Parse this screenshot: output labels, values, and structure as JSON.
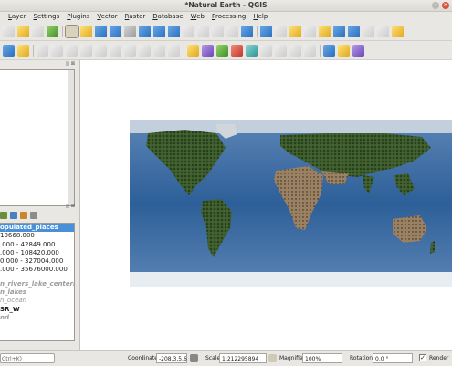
{
  "window": {
    "title": "*Natural Earth - QGIS"
  },
  "menubar": [
    "Layer",
    "Settings",
    "Plugins",
    "Vector",
    "Raster",
    "Database",
    "Web",
    "Processing",
    "Help"
  ],
  "layers": {
    "items": [
      {
        "label": "opulated_places",
        "style": "selected"
      },
      {
        "label": " 10668.000",
        "style": "normal"
      },
      {
        "label": ".000 - 42849.000",
        "style": "normal"
      },
      {
        "label": ".000 - 108420.000",
        "style": "normal"
      },
      {
        "label": "0.000 - 327004.000",
        "style": "normal"
      },
      {
        "label": ".000 - 35676000.000",
        "style": "normal"
      },
      {
        "label": "",
        "style": "gap"
      },
      {
        "label": "n_rivers_lake_centerli...",
        "style": "disabled"
      },
      {
        "label": "n_lakes",
        "style": "disabled"
      },
      {
        "label": "n_ocean",
        "style": "disabled-plain"
      },
      {
        "label": "SR_W",
        "style": "bold"
      },
      {
        "label": "nd",
        "style": "disabled"
      }
    ]
  },
  "statusbar": {
    "search_placeholder": "Ctrl+K)",
    "coordinate_label": "Coordinate",
    "coordinate_value": "-208.3,5.6",
    "scale_label": "Scale",
    "scale_value": "1:212295894",
    "magnifier_label": "Magnifier",
    "magnifier_value": "100%",
    "rotation_label": "Rotation",
    "rotation_value": "0.0 °",
    "render_label": "Render",
    "render_checked": "✓"
  },
  "colors": {
    "accent": "#4a90d9",
    "ocean": "#3e6fa6",
    "land": "#2f5a2c"
  }
}
